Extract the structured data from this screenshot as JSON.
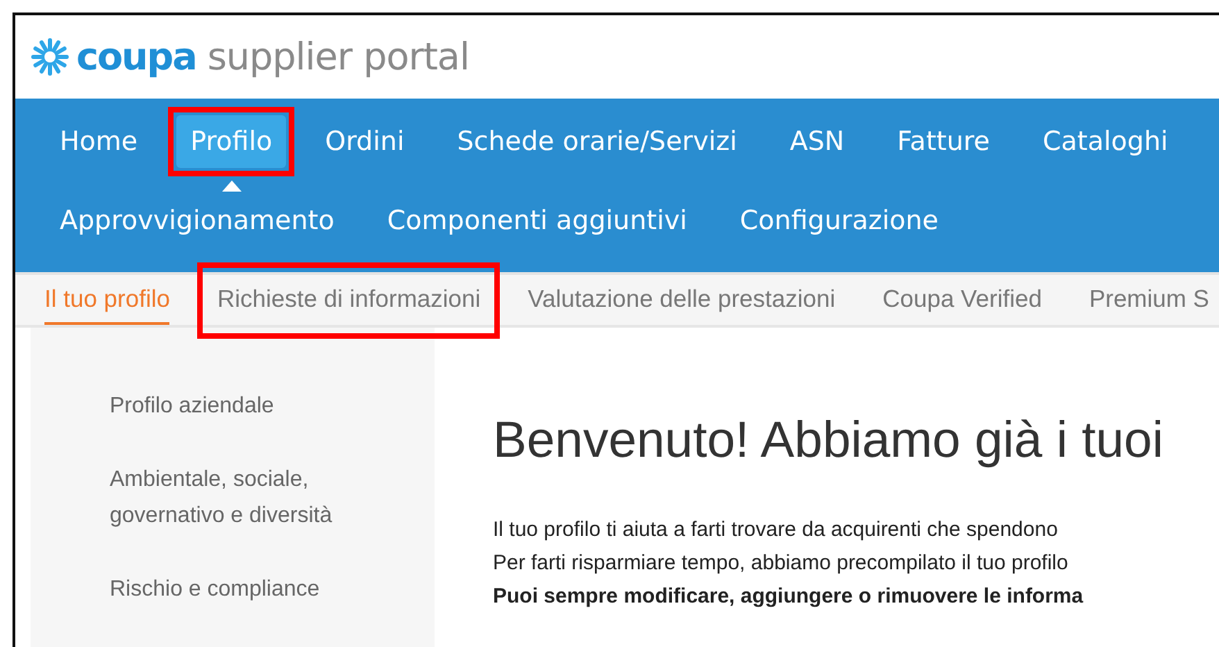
{
  "logo": {
    "brand": "coupa",
    "product": "supplier portal"
  },
  "nav": {
    "primary": [
      {
        "label": "Home",
        "selected": false,
        "highlighted": false
      },
      {
        "label": "Profilo",
        "selected": true,
        "highlighted": true
      },
      {
        "label": "Ordini",
        "selected": false,
        "highlighted": false
      },
      {
        "label": "Schede orarie/Servizi",
        "selected": false,
        "highlighted": false
      },
      {
        "label": "ASN",
        "selected": false,
        "highlighted": false
      },
      {
        "label": "Fatture",
        "selected": false,
        "highlighted": false
      },
      {
        "label": "Cataloghi",
        "selected": false,
        "highlighted": false
      }
    ],
    "secondary": [
      {
        "label": "Approvvigionamento",
        "selected": false,
        "highlighted": false
      },
      {
        "label": "Componenti aggiuntivi",
        "selected": false,
        "highlighted": false
      },
      {
        "label": "Configurazione",
        "selected": false,
        "highlighted": false
      }
    ]
  },
  "subtabs": [
    {
      "label": "Il tuo profilo",
      "selected": true,
      "highlighted": false
    },
    {
      "label": "Richieste di informazioni",
      "selected": false,
      "highlighted": true
    },
    {
      "label": "Valutazione delle prestazioni",
      "selected": false,
      "highlighted": false
    },
    {
      "label": "Coupa Verified",
      "selected": false,
      "highlighted": false
    },
    {
      "label": "Premium S",
      "selected": false,
      "highlighted": false
    }
  ],
  "sidebar": {
    "items": [
      "Profilo aziendale",
      "Ambientale, sociale, governativo e diversità",
      "Rischio e compliance"
    ]
  },
  "main": {
    "heading": "Benvenuto! Abbiamo già i tuoi",
    "paragraphs": [
      {
        "text": "Il tuo profilo ti aiuta a farti trovare da acquirenti che spendono",
        "bold": false
      },
      {
        "text": "Per farti risparmiare tempo, abbiamo precompilato il tuo profilo",
        "bold": false
      },
      {
        "text": "Puoi sempre modificare, aggiungere o rimuovere le informa",
        "bold": true
      }
    ]
  }
}
